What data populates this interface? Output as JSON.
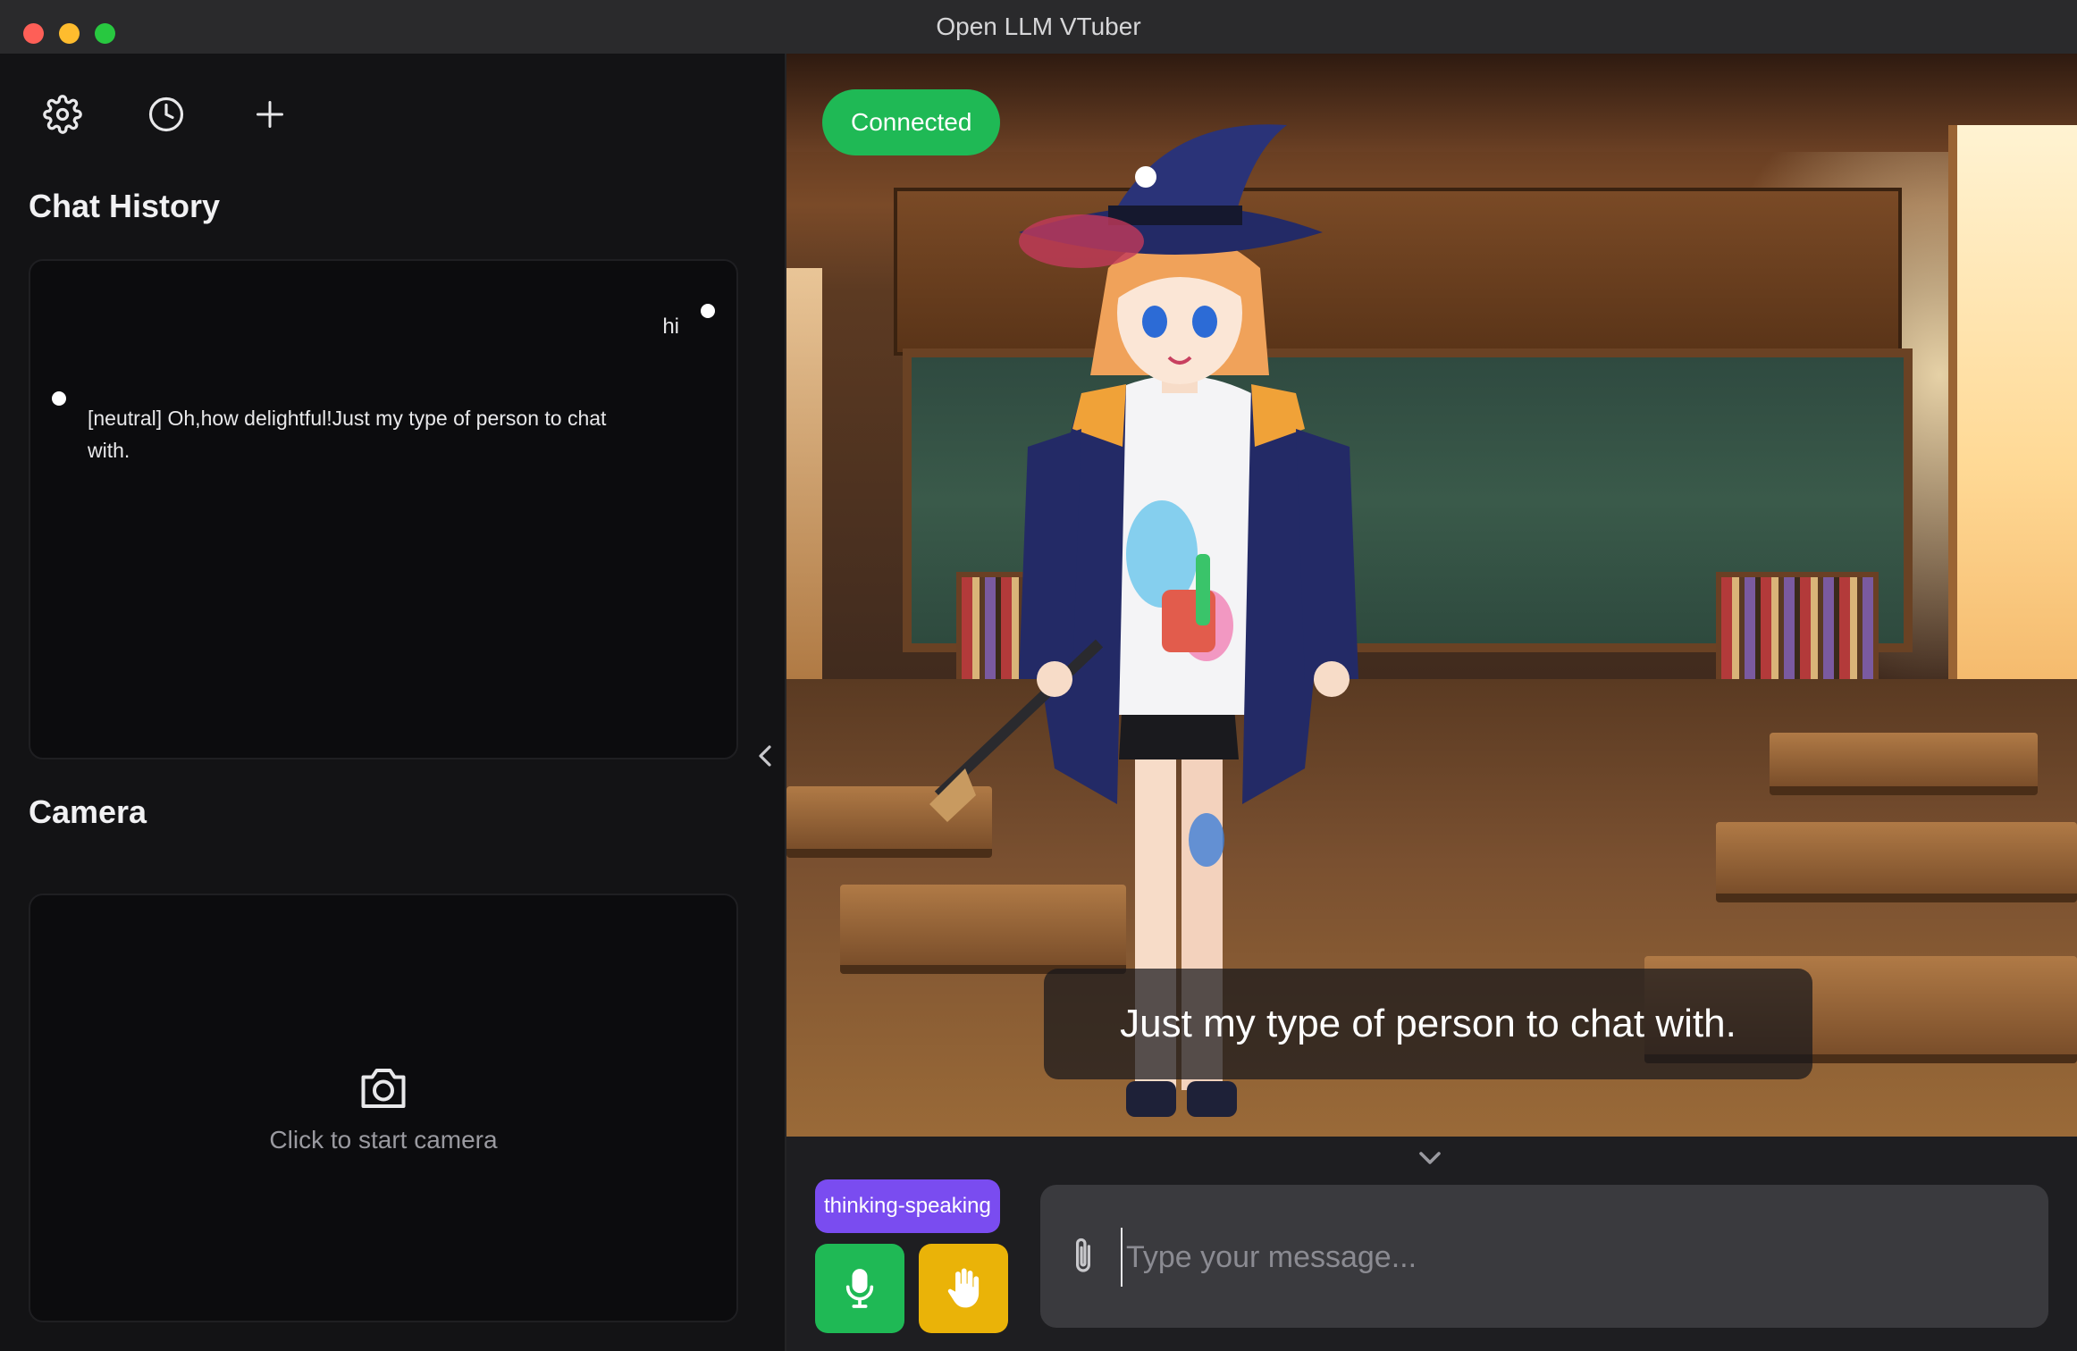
{
  "window": {
    "title": "Open LLM VTuber"
  },
  "sidebar": {
    "toolbar": {
      "settings_icon": "gear-icon",
      "history_icon": "clock-icon",
      "new_chat_icon": "plus-icon"
    },
    "chat_history": {
      "title": "Chat History",
      "messages": [
        {
          "role": "user",
          "text": "hi"
        },
        {
          "role": "ai",
          "text": "[neutral] Oh,how delightful!Just my type of person to chat with."
        }
      ]
    },
    "camera": {
      "title": "Camera",
      "prompt": "Click to start camera"
    }
  },
  "stage": {
    "status": "Connected",
    "subtitle": "Just my type of person to chat with."
  },
  "controls": {
    "state_badge": "thinking-speaking",
    "input_placeholder": "Type your message...",
    "input_value": ""
  },
  "colors": {
    "connected": "#1fb955",
    "state_badge": "#7a4cf0",
    "mic_button": "#1fb955",
    "interrupt_button": "#eab308"
  }
}
